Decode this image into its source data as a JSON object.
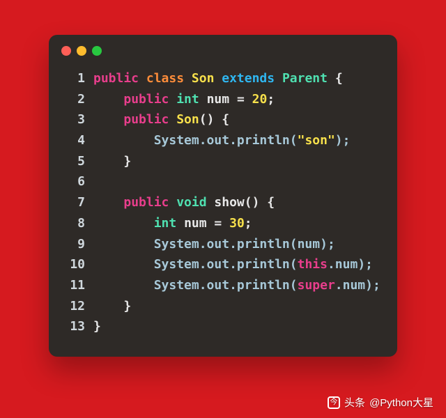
{
  "window": {
    "dots": [
      "#ff5f57",
      "#febc2e",
      "#28c840"
    ]
  },
  "code": {
    "lines": [
      [
        {
          "t": "public ",
          "c": "#e83e8c"
        },
        {
          "t": "class ",
          "c": "#ff8d3a"
        },
        {
          "t": "Son ",
          "c": "#f7e04b"
        },
        {
          "t": "extends ",
          "c": "#2fb6f0"
        },
        {
          "t": "Parent ",
          "c": "#4fe0b0"
        },
        {
          "t": "{",
          "c": "#e8e8e8"
        }
      ],
      [
        {
          "t": "    ",
          "c": "#e8e8e8"
        },
        {
          "t": "public ",
          "c": "#e83e8c"
        },
        {
          "t": "int ",
          "c": "#4fe0b0"
        },
        {
          "t": "num ",
          "c": "#e8e8e8"
        },
        {
          "t": "= ",
          "c": "#e8e8e8"
        },
        {
          "t": "20",
          "c": "#f7e04b"
        },
        {
          "t": ";",
          "c": "#e8e8e8"
        }
      ],
      [
        {
          "t": "    ",
          "c": "#e8e8e8"
        },
        {
          "t": "public ",
          "c": "#e83e8c"
        },
        {
          "t": "Son",
          "c": "#f7e04b"
        },
        {
          "t": "() {",
          "c": "#e8e8e8"
        }
      ],
      [
        {
          "t": "        System.out.println(",
          "c": "#a7c8d8"
        },
        {
          "t": "\"son\"",
          "c": "#f7e04b"
        },
        {
          "t": ");",
          "c": "#a7c8d8"
        }
      ],
      [
        {
          "t": "    }",
          "c": "#e8e8e8"
        }
      ],
      [
        {
          "t": " ",
          "c": "#e8e8e8"
        }
      ],
      [
        {
          "t": "    ",
          "c": "#e8e8e8"
        },
        {
          "t": "public ",
          "c": "#e83e8c"
        },
        {
          "t": "void ",
          "c": "#4fe0b0"
        },
        {
          "t": "show",
          "c": "#e8e8e8"
        },
        {
          "t": "() {",
          "c": "#e8e8e8"
        }
      ],
      [
        {
          "t": "        ",
          "c": "#e8e8e8"
        },
        {
          "t": "int ",
          "c": "#4fe0b0"
        },
        {
          "t": "num ",
          "c": "#e8e8e8"
        },
        {
          "t": "= ",
          "c": "#e8e8e8"
        },
        {
          "t": "30",
          "c": "#f7e04b"
        },
        {
          "t": ";",
          "c": "#e8e8e8"
        }
      ],
      [
        {
          "t": "        System.out.println(num);",
          "c": "#a7c8d8"
        }
      ],
      [
        {
          "t": "        System.out.println(",
          "c": "#a7c8d8"
        },
        {
          "t": "this",
          "c": "#e83e8c"
        },
        {
          "t": ".num);",
          "c": "#a7c8d8"
        }
      ],
      [
        {
          "t": "        System.out.println(",
          "c": "#a7c8d8"
        },
        {
          "t": "super",
          "c": "#e83e8c"
        },
        {
          "t": ".num);",
          "c": "#a7c8d8"
        }
      ],
      [
        {
          "t": "    }",
          "c": "#e8e8e8"
        }
      ],
      [
        {
          "t": "}",
          "c": "#e8e8e8"
        }
      ]
    ]
  },
  "footer": {
    "prefix": "头条",
    "handle": "@Python大星"
  }
}
